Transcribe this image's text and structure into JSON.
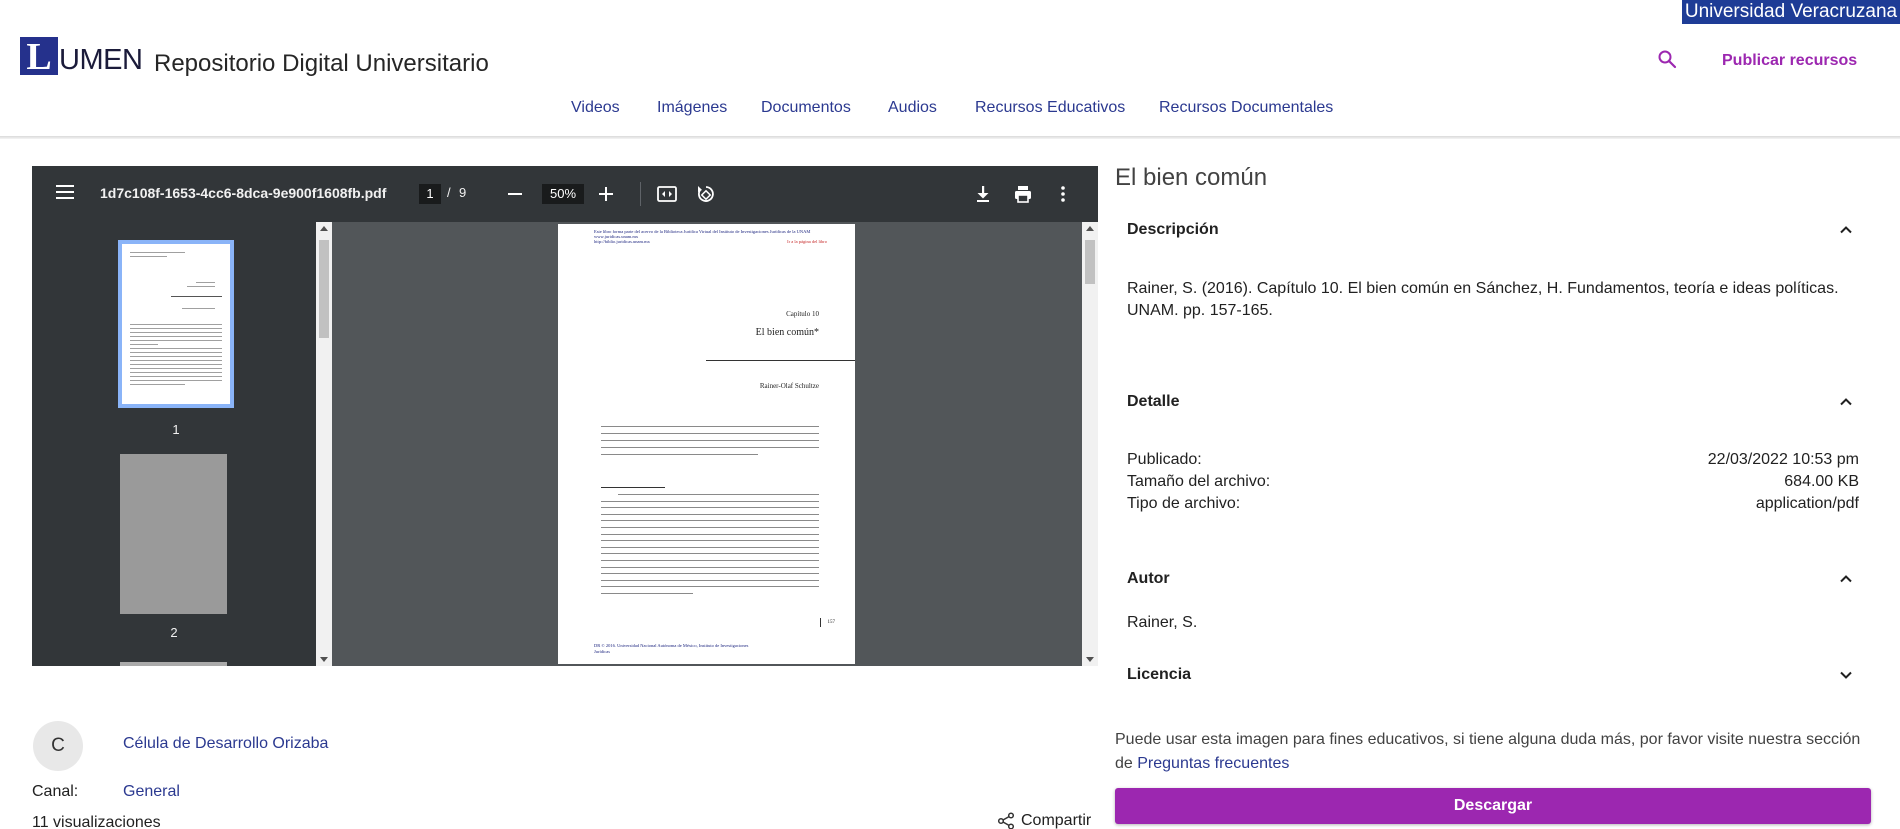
{
  "header": {
    "badge": "Universidad Veracruzana",
    "logo_letter": "L",
    "logo_rest": "UMEN",
    "site_title": "Repositorio Digital Universitario",
    "publish_label": "Publicar recursos",
    "search_icon": "search-icon",
    "accent_color": "#9c27b0",
    "brand_color": "#25318c"
  },
  "nav": {
    "items": [
      "Videos",
      "Imágenes",
      "Documentos",
      "Audios",
      "Recursos Educativos",
      "Recursos Documentales"
    ]
  },
  "viewer": {
    "filename": "1d7c108f-1653-4cc6-8dca-9e900f1608fb.pdf",
    "current_page": "1",
    "page_separator": "/",
    "total_pages": "9",
    "zoom": "50%",
    "thumbnails": [
      "1",
      "2"
    ],
    "page": {
      "header_line1": "Este libro forma parte del acervo de la Biblioteca Jurídica Virtual del Instituto de Investigaciones Jurídicas de la UNAM",
      "header_line2": "www.juridicas.unam.mx",
      "header_line3": "http://biblio.juridicas.unam.mx",
      "header_right": "Ir a la página del libro",
      "chapter": "Capítulo 10",
      "title": "El bien común*",
      "author": "Rainer-Olaf Schultze",
      "page_number": "157",
      "footer": "DR © 2016. Universidad Nacional Autónoma de México, Instituto de Investigaciones Jurídicas"
    }
  },
  "channel": {
    "avatar_letter": "C",
    "owner": "Célula de Desarrollo Orizaba",
    "label": "Canal:",
    "value": "General",
    "views": "11 visualizaciones",
    "share_label": "Compartir"
  },
  "details": {
    "title": "El bien común",
    "description_heading": "Descripción",
    "description": "Rainer, S. (2016). Capítulo 10. El bien común en Sánchez, H. Fundamentos, teoría e ideas políticas. UNAM. pp. 157-165.",
    "detail_heading": "Detalle",
    "published_label": "Publicado:",
    "published_value": "22/03/2022 10:53 pm",
    "size_label": "Tamaño del archivo:",
    "size_value": "684.00 KB",
    "type_label": "Tipo de archivo:",
    "type_value": "application/pdf",
    "author_heading": "Autor",
    "author_value": "Rainer, S.",
    "license_heading": "Licencia",
    "license_note": "Puede usar esta imagen para fines educativos, si tiene alguna duda más, por favor visite nuestra sección de ",
    "license_link": "Preguntas frecuentes",
    "download_label": "Descargar"
  }
}
